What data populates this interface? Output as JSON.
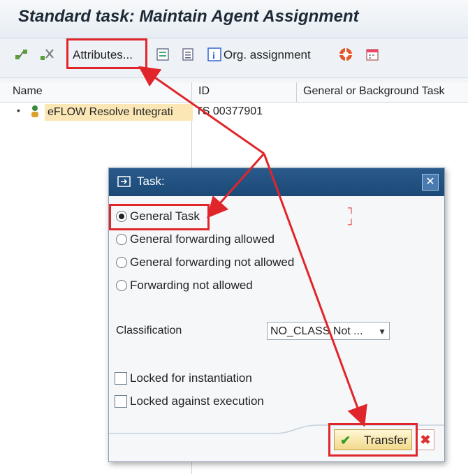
{
  "window": {
    "title": "Standard task: Maintain Agent Assignment"
  },
  "toolbar": {
    "attributes_label": "Attributes...",
    "org_assignment_label": "Org. assignment"
  },
  "tree": {
    "columns": [
      "Name",
      "ID",
      "General or Background Task"
    ],
    "rows": [
      {
        "name": "eFLOW Resolve Integrati",
        "id": "TS 00377901"
      }
    ]
  },
  "dialog": {
    "title": "Task:",
    "options": [
      {
        "label": "General Task",
        "selected": true
      },
      {
        "label": "General forwarding allowed",
        "selected": false
      },
      {
        "label": "General forwarding not allowed",
        "selected": false
      },
      {
        "label": "Forwarding not allowed",
        "selected": false
      }
    ],
    "classification_label": "Classification",
    "classification_value": "NO_CLASS Not ...",
    "checkboxes": [
      {
        "label": "Locked for instantiation",
        "checked": false
      },
      {
        "label": "Locked against execution",
        "checked": false
      }
    ],
    "transfer_label": "Transfer"
  },
  "colors": {
    "highlight": "#e0262a",
    "dialog_title_bg": "#1b4a78",
    "selected_row_bg": "#fbe7b5"
  }
}
